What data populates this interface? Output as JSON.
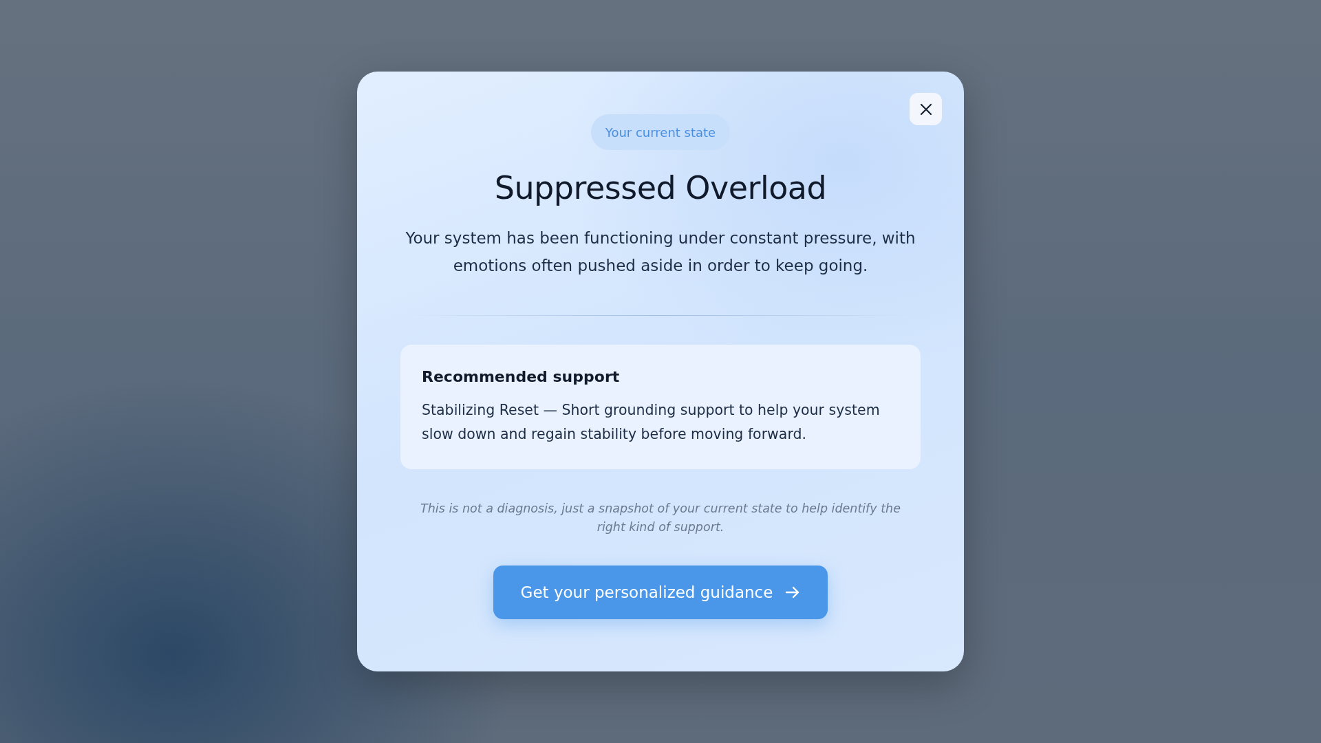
{
  "dialog": {
    "badge": "Your current state",
    "title": "Suppressed Overload",
    "description": "Your system has been functioning under constant pressure, with emotions often pushed aside in order to keep going.",
    "recommendation": {
      "heading": "Recommended support",
      "text": "Stabilizing Reset — Short grounding support to help your system slow down and regain stability before moving forward."
    },
    "disclaimer": "This is not a diagnosis, just a snapshot of your current state to help identify the right kind of support.",
    "button": "Get your personalized guidance"
  }
}
